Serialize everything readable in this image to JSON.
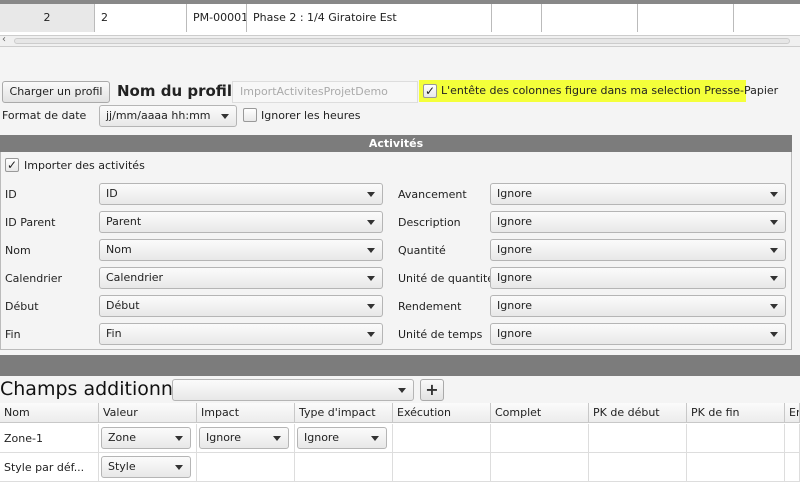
{
  "top_row": {
    "c1": "2",
    "c2": "2",
    "c3": "PM-00001",
    "c4": "Phase 2 : 1/4 Giratoire Est"
  },
  "profile": {
    "load_button": "Charger un profil",
    "name_label": "Nom du profil :",
    "name_placeholder": "ImportActivitesProjetDemo",
    "header_checkbox_label": "L'entête des colonnes figure dans ma selection Presse-Papier",
    "date_format_label": "Format de date",
    "date_format_value": "jj/mm/aaaa hh:mm",
    "ignore_hours_label": "Ignorer les heures"
  },
  "activities": {
    "title": "Activités",
    "import_label": "Importer des activités",
    "left": [
      {
        "label": "ID",
        "value": "ID"
      },
      {
        "label": "ID Parent",
        "value": "Parent"
      },
      {
        "label": "Nom",
        "value": "Nom"
      },
      {
        "label": "Calendrier",
        "value": "Calendrier"
      },
      {
        "label": "Début",
        "value": "Début"
      },
      {
        "label": "Fin",
        "value": "Fin"
      }
    ],
    "right": [
      {
        "label": "Avancement",
        "value": "Ignore"
      },
      {
        "label": "Description",
        "value": "Ignore"
      },
      {
        "label": "Quantité",
        "value": "Ignore"
      },
      {
        "label": "Unité de quantité",
        "value": "Ignore"
      },
      {
        "label": "Rendement",
        "value": "Ignore"
      },
      {
        "label": "Unité de temps",
        "value": "Ignore"
      }
    ]
  },
  "extra_fields": {
    "title": "Champs additionnels",
    "add": "+",
    "headers": [
      "Nom",
      "Valeur",
      "Impact",
      "Type d'impact",
      "Exécution",
      "Complet",
      "PK de début",
      "PK de fin",
      "Em"
    ],
    "rows": [
      {
        "name": "Zone-1",
        "value": "Zone",
        "impact": "Ignore",
        "impact_type": "Ignore"
      },
      {
        "name": "Style par déf...",
        "value": "Style"
      }
    ]
  },
  "colors": {
    "panel_header": "#7c7c7c",
    "highlight": "#f4ff3a"
  }
}
